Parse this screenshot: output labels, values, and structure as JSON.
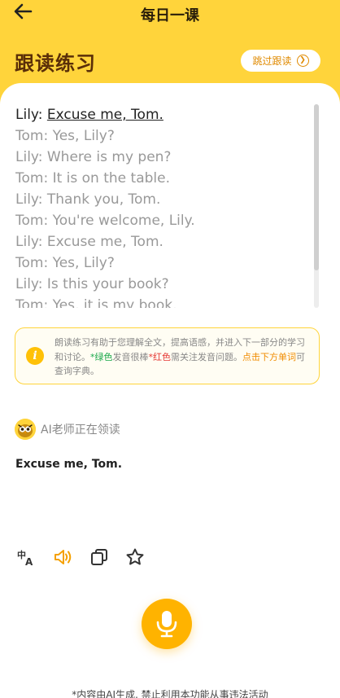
{
  "header": {
    "title": "每日一课",
    "back_icon": "arrow-left-icon"
  },
  "page": {
    "heading": "跟读练习",
    "skip_label": "跳过跟读",
    "skip_icon": "circle-chevron-right-icon"
  },
  "dialog": {
    "lines": [
      {
        "speaker": "Lily:",
        "text": "Excuse me, Tom.",
        "active": true
      },
      {
        "speaker": "Tom:",
        "text": "Yes, Lily?",
        "active": false
      },
      {
        "speaker": "Lily:",
        "text": "Where is my pen?",
        "active": false
      },
      {
        "speaker": "Tom:",
        "text": "It is on the table.",
        "active": false
      },
      {
        "speaker": "Lily:",
        "text": "Thank you, Tom.",
        "active": false
      },
      {
        "speaker": "Tom:",
        "text": "You're welcome, Lily.",
        "active": false
      },
      {
        "speaker": "Lily:",
        "text": "Excuse me, Tom.",
        "active": false
      },
      {
        "speaker": "Tom:",
        "text": "Yes, Lily?",
        "active": false
      },
      {
        "speaker": "Lily:",
        "text": "Is this your book?",
        "active": false
      },
      {
        "speaker": "Tom:",
        "text": "Yes, it is my book.",
        "active": false
      }
    ]
  },
  "tip": {
    "icon": "info-icon",
    "part1": "朗读练习有助于您理解全文，提高语感，并进入下一部分的学习和讨论。",
    "green_text": "*绿色",
    "part2": "发音很棒",
    "red_text": "*红色",
    "part3": "需关注发音问题。",
    "orange_text": "点击下方单词",
    "part4": "可查询字典。"
  },
  "ai": {
    "avatar_icon": "owl-avatar-icon",
    "status": "AI老师正在领读",
    "current_sentence": "Excuse me, Tom."
  },
  "toolbar": {
    "icons": [
      "translate-icon",
      "speaker-icon",
      "copy-icon",
      "star-icon"
    ]
  },
  "mic": {
    "icon": "microphone-icon"
  },
  "footer": {
    "disclaimer": "*内容由AI生成, 禁止利用本功能从事违法活动"
  },
  "colors": {
    "accent": "#ffd43b",
    "brand_dark": "#5a2e08",
    "orange": "#f08c00",
    "green": "#19a84a",
    "red": "#e53935"
  }
}
